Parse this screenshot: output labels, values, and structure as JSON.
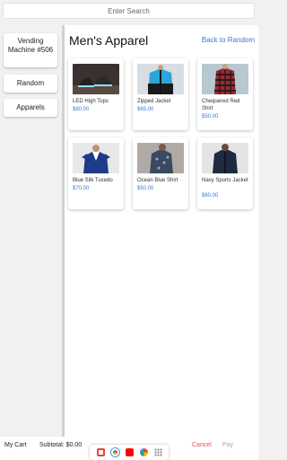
{
  "search": {
    "placeholder": "Enter Search"
  },
  "sidebar": {
    "items": [
      {
        "label": "Vending Machine #506"
      },
      {
        "label": "Random"
      },
      {
        "label": "Apparels"
      }
    ]
  },
  "main": {
    "title": "Men's Apparel",
    "back_label": "Back to Random",
    "products": [
      {
        "name": "LED High Tops",
        "price": "$80.00"
      },
      {
        "name": "Zipped Jacket",
        "price": "$65.00"
      },
      {
        "name": "Chequered Red Shirt",
        "price": "$50.00"
      },
      {
        "name": "Blue Silk Tuxedo",
        "price": "$70.00"
      },
      {
        "name": "Ocean Blue Shirt",
        "price": "$50.00"
      },
      {
        "name": "Navy Sports Jacket",
        "price": "$60.00"
      }
    ]
  },
  "bottom": {
    "cart_label": "My Cart",
    "subtotal_label": "Subtotal: $0.00",
    "cancel_label": "Cancel",
    "pay_label": "Pay"
  },
  "dock": {
    "icons": [
      "gmail-icon",
      "chrome-icon",
      "youtube-icon",
      "photos-icon",
      "apps-grid-icon"
    ]
  },
  "colors": {
    "accent": "#3b78d8",
    "cancel": "#e05050"
  }
}
